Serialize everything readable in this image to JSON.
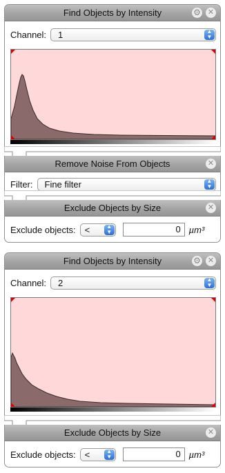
{
  "group1": {
    "intensity": {
      "title": "Find Objects by Intensity",
      "channel_label": "Channel:",
      "channel_value": "1",
      "histogram_shape": "sharp peak near low intensity then long decaying tail"
    },
    "noise": {
      "title": "Remove Noise From Objects",
      "filter_label": "Filter:",
      "filter_value": "Fine filter"
    },
    "size": {
      "title": "Exclude Objects by Size",
      "exclude_label": "Exclude objects:",
      "operator": "<",
      "value": "0",
      "unit": "µm³"
    }
  },
  "group2": {
    "intensity": {
      "title": "Find Objects by Intensity",
      "channel_label": "Channel:",
      "channel_value": "2",
      "histogram_shape": "decaying curve starting high at low intensity"
    },
    "size": {
      "title": "Exclude Objects by Size",
      "exclude_label": "Exclude objects:",
      "operator": "<",
      "value": "0",
      "unit": "µm³"
    }
  },
  "icons": {
    "close": "✕",
    "gear": "⚙",
    "popup_up": "▲",
    "popup_down": "▼"
  },
  "colors": {
    "histogram_background": "#ffd9d9",
    "histogram_fill": "#8a6a6a",
    "header_gray": "#a4a4a4",
    "popup_blue": "#2f6fd8"
  }
}
